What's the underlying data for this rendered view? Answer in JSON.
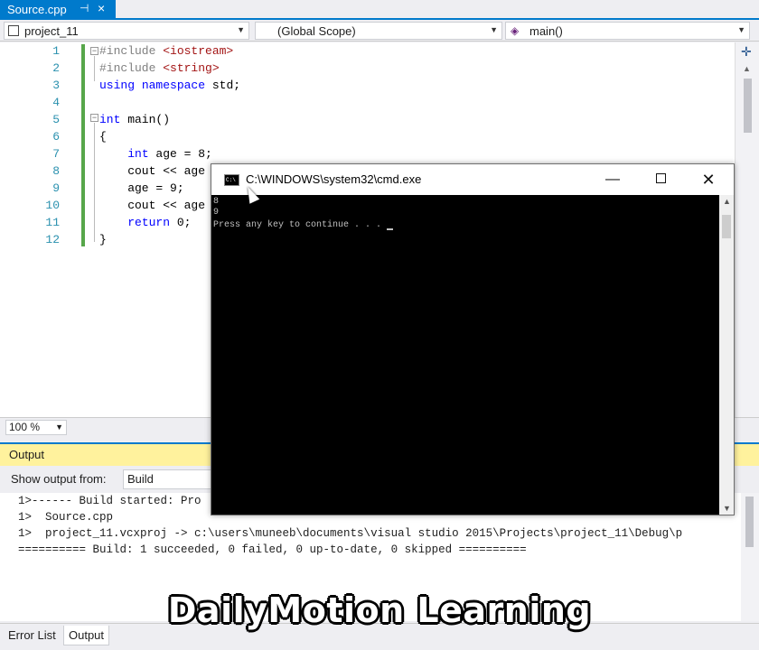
{
  "colors": {
    "accent": "#007acc",
    "output_title_bg": "#fff29d",
    "line_number": "#2b91af",
    "keyword": "#0000ff",
    "string": "#a31515",
    "change_bar": "#57a64a"
  },
  "document_tab": {
    "title": "Source.cpp",
    "pin_icon": "pin-icon",
    "close_icon": "close-icon"
  },
  "navbar": {
    "project": "project_11",
    "scope": "(Global Scope)",
    "function": "main()"
  },
  "editor": {
    "line_numbers": [
      "1",
      "2",
      "3",
      "4",
      "5",
      "6",
      "7",
      "8",
      "9",
      "10",
      "11",
      "12"
    ],
    "lines": [
      {
        "parts": [
          {
            "t": "#include ",
            "c": "pp"
          },
          {
            "t": "<iostream>",
            "c": "str"
          }
        ]
      },
      {
        "parts": [
          {
            "t": "#include ",
            "c": "pp"
          },
          {
            "t": "<string>",
            "c": "str"
          }
        ]
      },
      {
        "parts": [
          {
            "t": "using",
            "c": "kw"
          },
          {
            "t": " ",
            "c": ""
          },
          {
            "t": "namespace",
            "c": "kw"
          },
          {
            "t": " std;",
            "c": ""
          }
        ]
      },
      {
        "parts": []
      },
      {
        "parts": [
          {
            "t": "int",
            "c": "kw"
          },
          {
            "t": " main()",
            "c": ""
          }
        ]
      },
      {
        "parts": [
          {
            "t": "{",
            "c": ""
          }
        ]
      },
      {
        "parts": [
          {
            "t": "    ",
            "c": ""
          },
          {
            "t": "int",
            "c": "kw"
          },
          {
            "t": " age = 8;",
            "c": ""
          }
        ]
      },
      {
        "parts": [
          {
            "t": "    cout << age",
            "c": ""
          }
        ]
      },
      {
        "parts": [
          {
            "t": "    age = 9;",
            "c": ""
          }
        ]
      },
      {
        "parts": [
          {
            "t": "    cout << age",
            "c": ""
          }
        ]
      },
      {
        "parts": [
          {
            "t": "    ",
            "c": ""
          },
          {
            "t": "return",
            "c": "kw"
          },
          {
            "t": " 0;",
            "c": ""
          }
        ]
      },
      {
        "parts": [
          {
            "t": "}",
            "c": ""
          }
        ]
      }
    ]
  },
  "zoom": "100 %",
  "output": {
    "title": "Output",
    "show_from_label": "Show output from:",
    "show_from_value": "Build",
    "lines": [
      "1>------ Build started: Pro",
      "1>  Source.cpp",
      "1>  project_11.vcxproj -> c:\\users\\muneeb\\documents\\visual studio 2015\\Projects\\project_11\\Debug\\p",
      "========== Build: 1 succeeded, 0 failed, 0 up-to-date, 0 skipped =========="
    ]
  },
  "bottom_tabs": [
    "Error List",
    "Output"
  ],
  "console": {
    "title": "C:\\WINDOWS\\system32\\cmd.exe",
    "icon_text": "C:\\",
    "lines": [
      "8",
      "9",
      "Press any key to continue . . . "
    ]
  },
  "watermark": "DailyMotion Learning"
}
